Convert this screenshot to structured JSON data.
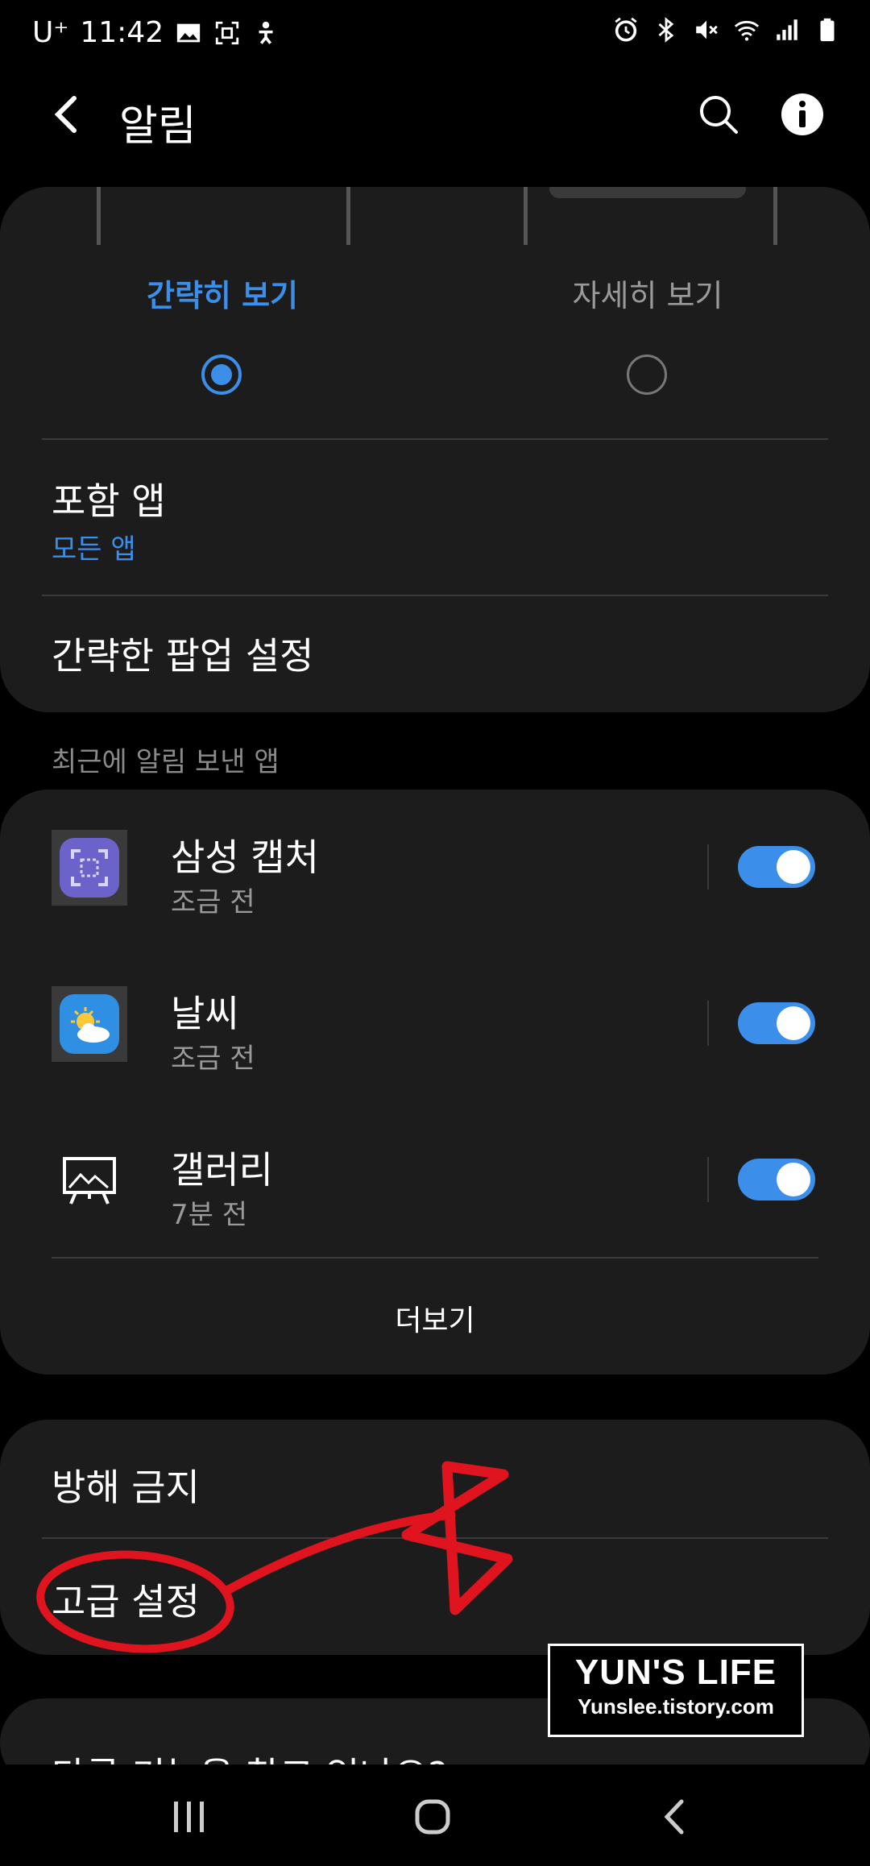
{
  "status_bar": {
    "carrier": "U⁺",
    "time": "11:42"
  },
  "app_bar": {
    "title": "알림"
  },
  "notification_style": {
    "option_simple": "간략히 보기",
    "option_detail": "자세히 보기",
    "selected": "간략히 보기"
  },
  "settings_top": {
    "included_apps_title": "포함 앱",
    "included_apps_value": "모든 앱",
    "brief_popup_label": "간략한 팝업 설정"
  },
  "recent_section": {
    "header": "최근에 알림 보낸 앱",
    "apps": [
      {
        "name": "삼성 캡처",
        "time": "조금 전",
        "icon": "samsung-capture-icon",
        "enabled": true
      },
      {
        "name": "날씨",
        "time": "조금 전",
        "icon": "weather-icon",
        "enabled": true
      },
      {
        "name": "갤러리",
        "time": "7분 전",
        "icon": "gallery-icon",
        "enabled": true
      }
    ],
    "more_label": "더보기"
  },
  "settings_bottom": {
    "dnd_label": "방해 금지",
    "advanced_label": "고급 설정"
  },
  "partial_card": {
    "label": "다른 기능을 찾고 있나요?"
  },
  "watermark": {
    "title": "YUN'S LIFE",
    "url": "Yunslee.tistory.com"
  },
  "colors": {
    "accent": "#3b8eea",
    "card_bg": "#1c1c1c",
    "annotation": "#e0141e"
  }
}
